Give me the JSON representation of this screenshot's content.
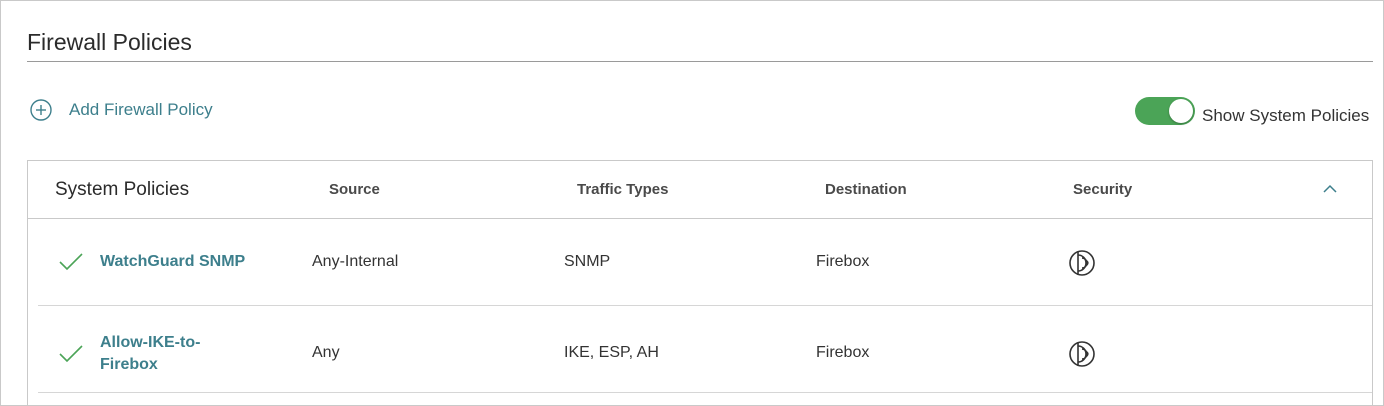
{
  "page": {
    "title": "Firewall Policies"
  },
  "toolbar": {
    "add_label": "Add Firewall Policy",
    "add_icon": "plus-circle-icon",
    "toggle_label": "Show System Policies",
    "toggle_on": true
  },
  "table": {
    "headers": [
      "System Policies",
      "Source",
      "Traffic Types",
      "Destination",
      "Security"
    ],
    "collapse_icon": "chevron-up-icon",
    "rows": [
      {
        "status_icon": "check-icon",
        "name": "WatchGuard SNMP",
        "source": "Any-Internal",
        "traffic": "SNMP",
        "destination": "Firebox",
        "security_icon": "security-services-icon"
      },
      {
        "status_icon": "check-icon",
        "name": "Allow-IKE-to-Firebox",
        "name_lines": [
          "Allow-IKE-to-",
          "Firebox"
        ],
        "source": "Any",
        "traffic": "IKE, ESP, AH",
        "destination": "Firebox",
        "security_icon": "security-services-icon"
      }
    ]
  },
  "colors": {
    "accent": "#3d7f8c",
    "toggle_on": "#4ba457",
    "check": "#4ba457"
  }
}
